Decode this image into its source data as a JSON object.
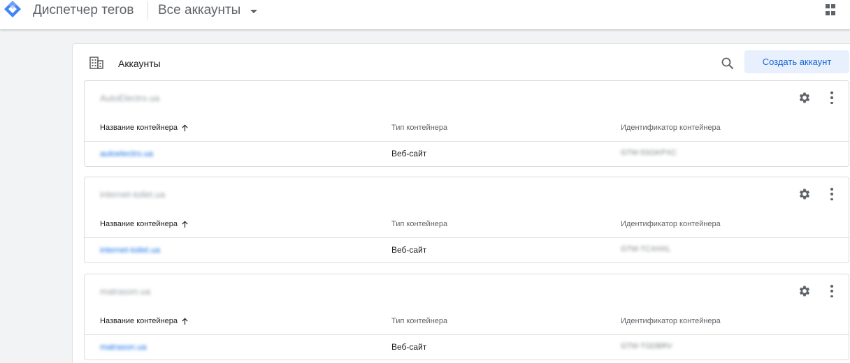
{
  "header": {
    "app_title": "Диспетчер тегов",
    "account_selector": "Все аккаунты",
    "logo_icon": "tag-manager-logo-icon",
    "apps_icon": "apps-grid-icon"
  },
  "panel": {
    "title": "Аккаунты",
    "create_button": "Создать аккаунт",
    "accent_color": "#1967d2"
  },
  "columns": {
    "name": "Название контейнера",
    "type": "Тип контейнера",
    "id": "Идентификатор контейнера"
  },
  "accounts": [
    {
      "name": "AutoElectro.ua",
      "container": "autoelectro.ua",
      "type": "Веб-сайт",
      "container_id": "GTM-5SGKPXC"
    },
    {
      "name": "internet-toilet.ua",
      "container": "internet-toilet.ua",
      "type": "Веб-сайт",
      "container_id": "GTM-TCXHXL"
    },
    {
      "name": "matrason.ua",
      "container": "matrason.ua",
      "type": "Веб-сайт",
      "container_id": "GTM-TGDBRV"
    }
  ]
}
